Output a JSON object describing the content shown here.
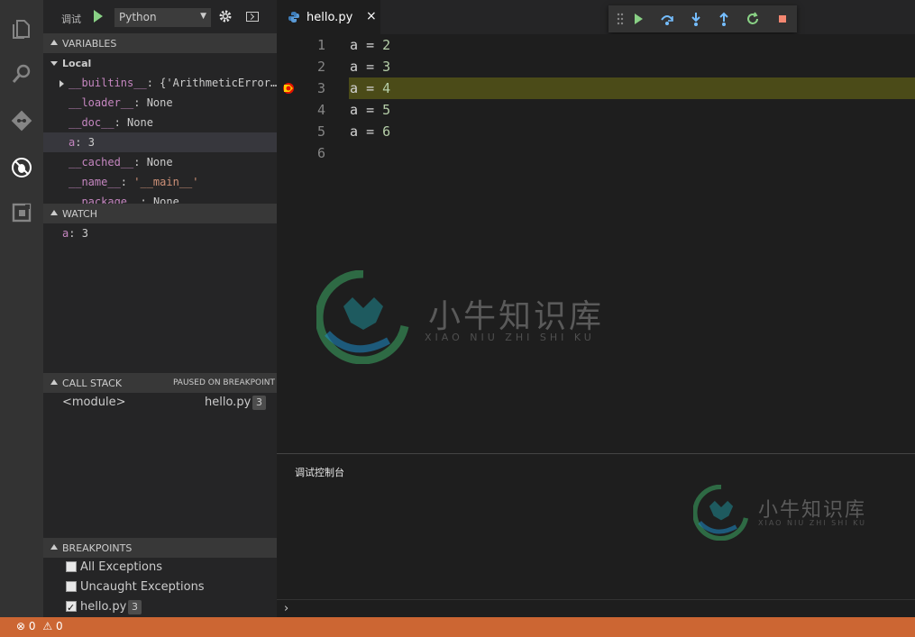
{
  "colors": {
    "statusbar": "#cc6633",
    "current_line": "#4b4b18",
    "breakpoint": "#e51400",
    "keyword": "#c586c0",
    "number": "#b5cea8"
  },
  "activity_bar": {
    "items": [
      {
        "name": "explorer-icon"
      },
      {
        "name": "search-icon"
      },
      {
        "name": "git-icon"
      },
      {
        "name": "debug-icon"
      },
      {
        "name": "extensions-icon"
      }
    ]
  },
  "debug_toolbar": {
    "title": "调试",
    "config": "Python",
    "start_icon": "play-icon",
    "settings_icon": "gear-icon",
    "console_icon": "terminal-icon"
  },
  "variables": {
    "header": "VARIABLES",
    "scope": "Local",
    "items": [
      {
        "name": "__builtins__",
        "value": "{'ArithmeticError…",
        "expandable": true
      },
      {
        "name": "__loader__",
        "value": "None"
      },
      {
        "name": "__doc__",
        "value": "None"
      },
      {
        "name": "a",
        "value": "3",
        "selected": true
      },
      {
        "name": "__cached__",
        "value": "None"
      },
      {
        "name": "__name__",
        "value": "'__main__'"
      },
      {
        "name": "__package__",
        "value": "None"
      }
    ]
  },
  "watch": {
    "header": "WATCH",
    "items": [
      {
        "name": "a",
        "value": "3"
      }
    ]
  },
  "call_stack": {
    "header": "CALL STACK",
    "status": "PAUSED ON BREAKPOINT",
    "frames": [
      {
        "name": "<module>",
        "file": "hello.py",
        "line": "3"
      }
    ]
  },
  "breakpoints": {
    "header": "BREAKPOINTS",
    "items": [
      {
        "label": "All Exceptions",
        "checked": false
      },
      {
        "label": "Uncaught Exceptions",
        "checked": false
      },
      {
        "label": "hello.py",
        "checked": true,
        "line": "3"
      }
    ]
  },
  "editor": {
    "tab": {
      "label": "hello.py",
      "close": "×"
    },
    "lines": [
      {
        "num": "1",
        "var": "a",
        "op": "=",
        "value": "2"
      },
      {
        "num": "2",
        "var": "a",
        "op": "=",
        "value": "3"
      },
      {
        "num": "3",
        "var": "a",
        "op": "=",
        "value": "4",
        "current": true,
        "breakpoint": true
      },
      {
        "num": "4",
        "var": "a",
        "op": "=",
        "value": "5"
      },
      {
        "num": "5",
        "var": "a",
        "op": "=",
        "value": "6"
      },
      {
        "num": "6",
        "var": "",
        "op": "",
        "value": ""
      }
    ]
  },
  "float_toolbar": {
    "buttons": [
      {
        "name": "drag-handle-icon"
      },
      {
        "name": "continue-icon"
      },
      {
        "name": "step-over-icon"
      },
      {
        "name": "step-into-icon"
      },
      {
        "name": "step-out-icon"
      },
      {
        "name": "restart-icon"
      },
      {
        "name": "stop-icon"
      }
    ]
  },
  "panel": {
    "title": "调试控制台",
    "prompt": "›"
  },
  "watermark": {
    "text": "小牛知识库",
    "sub": "XIAO NIU ZHI SHI KU"
  },
  "statusbar": {
    "errors": "0",
    "warnings": "0"
  }
}
